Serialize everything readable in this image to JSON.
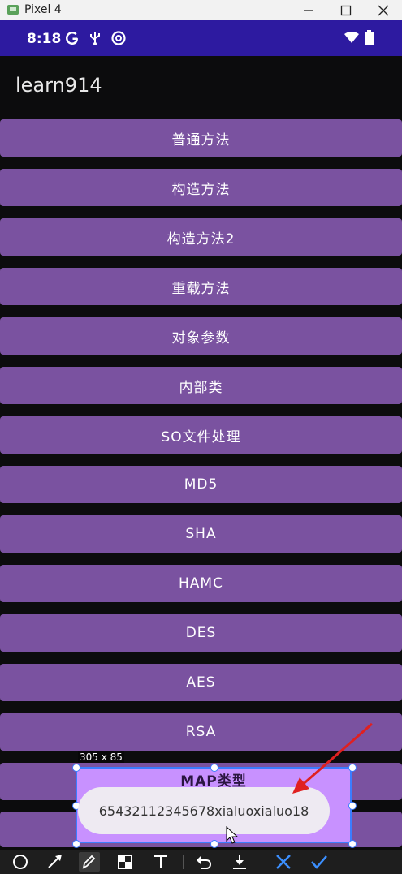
{
  "window": {
    "title": "Pixel 4"
  },
  "status_bar": {
    "time": "8:18"
  },
  "app": {
    "title": "learn914"
  },
  "buttons": [
    {
      "label": "普通方法"
    },
    {
      "label": "构造方法"
    },
    {
      "label": "构造方法2"
    },
    {
      "label": "重载方法"
    },
    {
      "label": "对象参数"
    },
    {
      "label": "内部类"
    },
    {
      "label": "SO文件处理"
    },
    {
      "label": "MD5"
    },
    {
      "label": "SHA"
    },
    {
      "label": "HAMC"
    },
    {
      "label": "DES"
    },
    {
      "label": "AES"
    },
    {
      "label": "RSA"
    },
    {
      "label": "MAP类型"
    }
  ],
  "overlay": {
    "selection_size": "305 x 85",
    "toast_text": "65432112345678xialuoxialuo18"
  },
  "colors": {
    "status_bar": "#2d1aa0",
    "button": "#7a52a0",
    "selection_border": "#3b7dff",
    "arrow": "#e02020"
  },
  "toolbar_icons": [
    "circle-icon",
    "arrow-tool-icon",
    "pencil-icon",
    "mosaic-icon",
    "text-icon",
    "undo-icon",
    "download-icon",
    "cancel-icon",
    "confirm-icon"
  ]
}
